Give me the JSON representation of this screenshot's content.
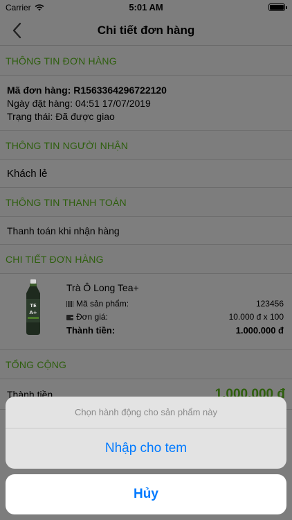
{
  "status_bar": {
    "carrier": "Carrier",
    "time": "5:01 AM"
  },
  "nav": {
    "title": "Chi tiết đơn hàng"
  },
  "order_info": {
    "header": "THÔNG TIN ĐƠN HÀNG",
    "code_line": "Mã đơn hàng: R1563364296722120",
    "date_line": "Ngày đặt hàng: 04:51 17/07/2019",
    "status_line": "Trạng thái: Đã được giao"
  },
  "receiver": {
    "header": "THÔNG TIN NGƯỜI NHẬN",
    "name": "Khách lẻ"
  },
  "payment": {
    "header": "THÔNG TIN THANH TOÁN",
    "method": "Thanh toán khi nhận hàng"
  },
  "order_detail": {
    "header": "CHI TIẾT ĐƠN HÀNG",
    "product": {
      "name": "Trà Ô Long Tea+",
      "code_label": "Mã sản phẩm:",
      "code_value": "123456",
      "price_label": "Đơn giá:",
      "price_value": "10.000 đ x 100",
      "subtotal_label": "Thành tiền:",
      "subtotal_value": "1.000.000 đ",
      "image_text": "TEA+"
    }
  },
  "total": {
    "header": "TỔNG CỘNG",
    "label": "Thành tiền",
    "value": "1.000.000 đ"
  },
  "action_sheet": {
    "title": "Chọn hành động cho sản phẩm này",
    "action": "Nhập cho tem",
    "cancel": "Hủy"
  },
  "colors": {
    "accent_green": "#2d5e0c",
    "ios_blue": "#007aff",
    "dim_overlay": "#7d7d7d"
  }
}
